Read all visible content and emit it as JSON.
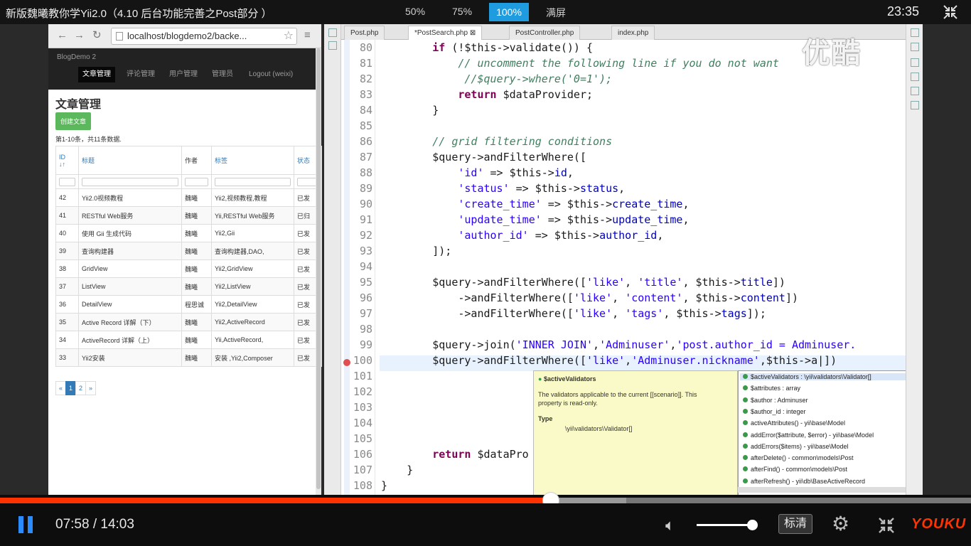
{
  "topbar": {
    "title": "新版魏曦教你学Yii2.0（4.10 后台功能完善之Post部分 ）",
    "zoom_50": "50%",
    "zoom_75": "75%",
    "zoom_100": "100%",
    "fullscreen": "满屏",
    "clock": "23:35"
  },
  "browser": {
    "back_icon": "arrow-left-icon",
    "address": "localhost/blogdemo2/backe...",
    "brand": "BlogDemo 2",
    "nav": [
      "文章管理",
      "评论管理",
      "用户管理",
      "管理员",
      "Logout (weixi)"
    ],
    "page_title": "文章管理",
    "create_button": "创建文章",
    "summary": "第1-10条，共11条数据.",
    "columns": [
      "ID",
      "标题",
      "作者",
      "标签",
      "状态"
    ],
    "id_sort_glyph": "↓↑",
    "rows": [
      [
        "42",
        "Yii2.0视频教程",
        "魏曦",
        "Yii2,视频教程,教程",
        "已发"
      ],
      [
        "41",
        "RESTful Web服务",
        "魏曦",
        "Yii,RESTful Web服务",
        "已归"
      ],
      [
        "40",
        "使用 Gii 生成代码",
        "魏曦",
        "Yii2,Gii",
        "已发"
      ],
      [
        "39",
        "查询构建器",
        "魏曦",
        "查询构建器,DAO,",
        "已发"
      ],
      [
        "38",
        "GridView",
        "魏曦",
        "Yii2,GridView",
        "已发"
      ],
      [
        "37",
        "ListView",
        "魏曦",
        "Yii2,ListView",
        "已发"
      ],
      [
        "36",
        "DetailView",
        "程思诚",
        "Yii2,DetailView",
        "已发"
      ],
      [
        "35",
        "Active Record 详解（下）",
        "魏曦",
        "Yii2,ActiveRecord",
        "已发"
      ],
      [
        "34",
        "ActiveRecord 详解（上）",
        "魏曦",
        "Yii,ActiveRecord,",
        "已发"
      ],
      [
        "33",
        "Yii2安装",
        "魏曦",
        "安装 ,Yii2,Composer",
        "已发"
      ]
    ],
    "pager": [
      "«",
      "1",
      "2",
      "»"
    ],
    "pager_active": "1"
  },
  "ide": {
    "tabs": [
      "Post.php",
      "*PostSearch.php",
      "PostController.php",
      "index.php"
    ],
    "active_tab": "*PostSearch.php",
    "line_numbers": [
      "80",
      "81",
      "82",
      "83",
      "84",
      "85",
      "86",
      "87",
      "88",
      "89",
      "90",
      "91",
      "92",
      "93",
      "94",
      "95",
      "96",
      "97",
      "98",
      "99",
      "100",
      "101",
      "102",
      "103",
      "104",
      "105",
      "106",
      "107",
      "108"
    ],
    "popup_member": "$activeValidators",
    "popup_desc1": "The validators applicable to the current [[scenario]]. This",
    "popup_desc2": "property is read-only.",
    "popup_type_label": "Type",
    "popup_type": "\\yii\\validators\\Validator[]",
    "completions": [
      "$activeValidators : \\yii\\validators\\Validator[]",
      "$attributes : array",
      "$author : Adminuser",
      "$author_id : integer",
      "activeAttributes() - yii\\base\\Model",
      "addError($attribute, $error) - yii\\base\\Model",
      "addErrors($items) - yii\\base\\Model",
      "afterDelete() - common\\models\\Post",
      "afterFind() - common\\models\\Post",
      "afterRefresh() - yii\\db\\BaseActiveRecord"
    ],
    "watermark": "优酷"
  },
  "player": {
    "time": "07:58 / 14:03",
    "progress": 0.567,
    "buffered": 0.645,
    "volume": 0.97,
    "quality": "标清",
    "logo": "YOUKU",
    "colors": {
      "accent": "#ff3300",
      "pause": "#2a8cff",
      "zoom_active": "#1f9be0"
    }
  }
}
